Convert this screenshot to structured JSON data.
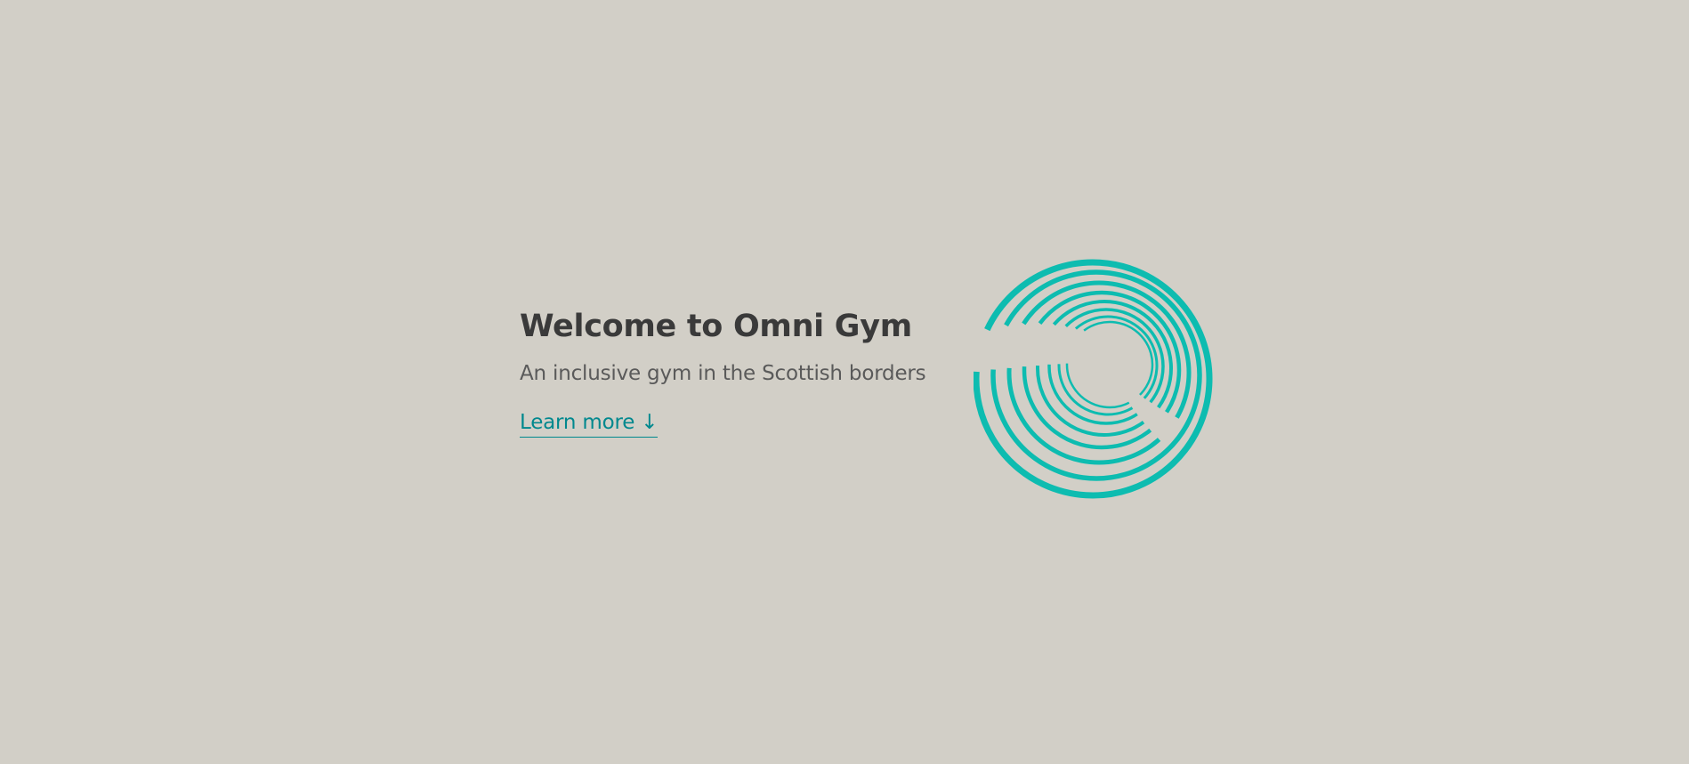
{
  "hero": {
    "title": "Welcome to Omni Gym",
    "subtitle": "An inclusive gym in the Scottish borders",
    "cta_label": "Learn more ↓"
  },
  "logo": {
    "icon": "concentric-rings-logo-icon",
    "color": "#0dbcb0"
  },
  "colors": {
    "background": "#d2cfc7",
    "title": "#3a3a3a",
    "subtitle": "#5a5a5a",
    "link": "#00888e"
  }
}
